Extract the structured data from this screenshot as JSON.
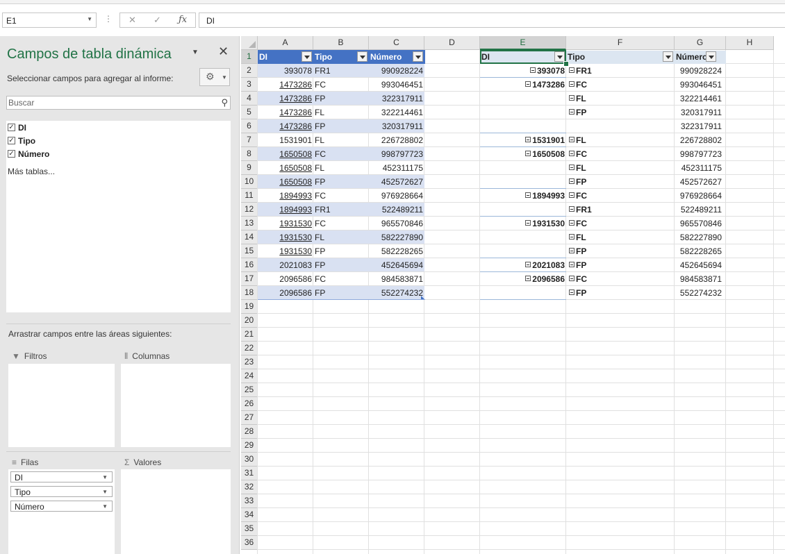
{
  "formula_bar": {
    "name_box": "E1",
    "formula": "DI"
  },
  "pivot_pane": {
    "title": "Campos de tabla dinámica",
    "subtitle": "Seleccionar campos para agregar al informe:",
    "search_placeholder": "Buscar",
    "fields": [
      {
        "label": "DI",
        "checked": true
      },
      {
        "label": "Tipo",
        "checked": true
      },
      {
        "label": "Número",
        "checked": true
      }
    ],
    "more_tables": "Más tablas...",
    "drag_hint": "Arrastrar campos entre las áreas siguientes:",
    "areas": {
      "filters": "Filtros",
      "columns": "Columnas",
      "rows": "Filas",
      "values": "Valores"
    },
    "row_fields": [
      "DI",
      "Tipo",
      "Número"
    ]
  },
  "sheet": {
    "columns": [
      "A",
      "B",
      "C",
      "D",
      "E",
      "F",
      "G",
      "H"
    ],
    "selected_column": "E",
    "row_numbers": [
      "1",
      "2",
      "3",
      "4",
      "5",
      "6",
      "7",
      "8",
      "9",
      "10",
      "11",
      "12",
      "13",
      "14",
      "15",
      "16",
      "17",
      "18",
      "19",
      "20",
      "21",
      "22",
      "23",
      "24",
      "25",
      "26",
      "27",
      "28",
      "29",
      "30",
      "31",
      "32",
      "33",
      "34",
      "35",
      "36"
    ],
    "source_table": {
      "headers": [
        "DI",
        "Tipo",
        "Número"
      ],
      "rows": [
        [
          "393078",
          "FR1",
          "990928224"
        ],
        [
          "1473286",
          "FC",
          "993046451"
        ],
        [
          "1473286",
          "FP",
          "322317911"
        ],
        [
          "1473286",
          "FL",
          "322214461"
        ],
        [
          "1473286",
          "FP",
          "320317911"
        ],
        [
          "1531901",
          "FL",
          "226728802"
        ],
        [
          "1650508",
          "FC",
          "998797723"
        ],
        [
          "1650508",
          "FL",
          "452311175"
        ],
        [
          "1650508",
          "FP",
          "452572627"
        ],
        [
          "1894993",
          "FC",
          "976928664"
        ],
        [
          "1894993",
          "FR1",
          "522489211"
        ],
        [
          "1931530",
          "FC",
          "965570846"
        ],
        [
          "1931530",
          "FL",
          "582227890"
        ],
        [
          "1931530",
          "FP",
          "582228265"
        ],
        [
          "2021083",
          "FP",
          "452645694"
        ],
        [
          "2096586",
          "FC",
          "984583871"
        ],
        [
          "2096586",
          "FP",
          "552274232"
        ]
      ]
    },
    "pivot_table": {
      "headers": [
        "DI",
        "Tipo",
        "Número"
      ],
      "rows": [
        [
          "393078",
          "FR1",
          "990928224"
        ],
        [
          "1473286",
          "FC",
          "993046451"
        ],
        [
          "",
          "FL",
          "322214461"
        ],
        [
          "",
          "FP",
          "320317911"
        ],
        [
          "",
          "",
          "322317911"
        ],
        [
          "1531901",
          "FL",
          "226728802"
        ],
        [
          "1650508",
          "FC",
          "998797723"
        ],
        [
          "",
          "FL",
          "452311175"
        ],
        [
          "",
          "FP",
          "452572627"
        ],
        [
          "1894993",
          "FC",
          "976928664"
        ],
        [
          "",
          "FR1",
          "522489211"
        ],
        [
          "1931530",
          "FC",
          "965570846"
        ],
        [
          "",
          "FL",
          "582227890"
        ],
        [
          "",
          "FP",
          "582228265"
        ],
        [
          "2021083",
          "FP",
          "452645694"
        ],
        [
          "2096586",
          "FC",
          "984583871"
        ],
        [
          "",
          "FP",
          "552274232"
        ]
      ]
    }
  }
}
